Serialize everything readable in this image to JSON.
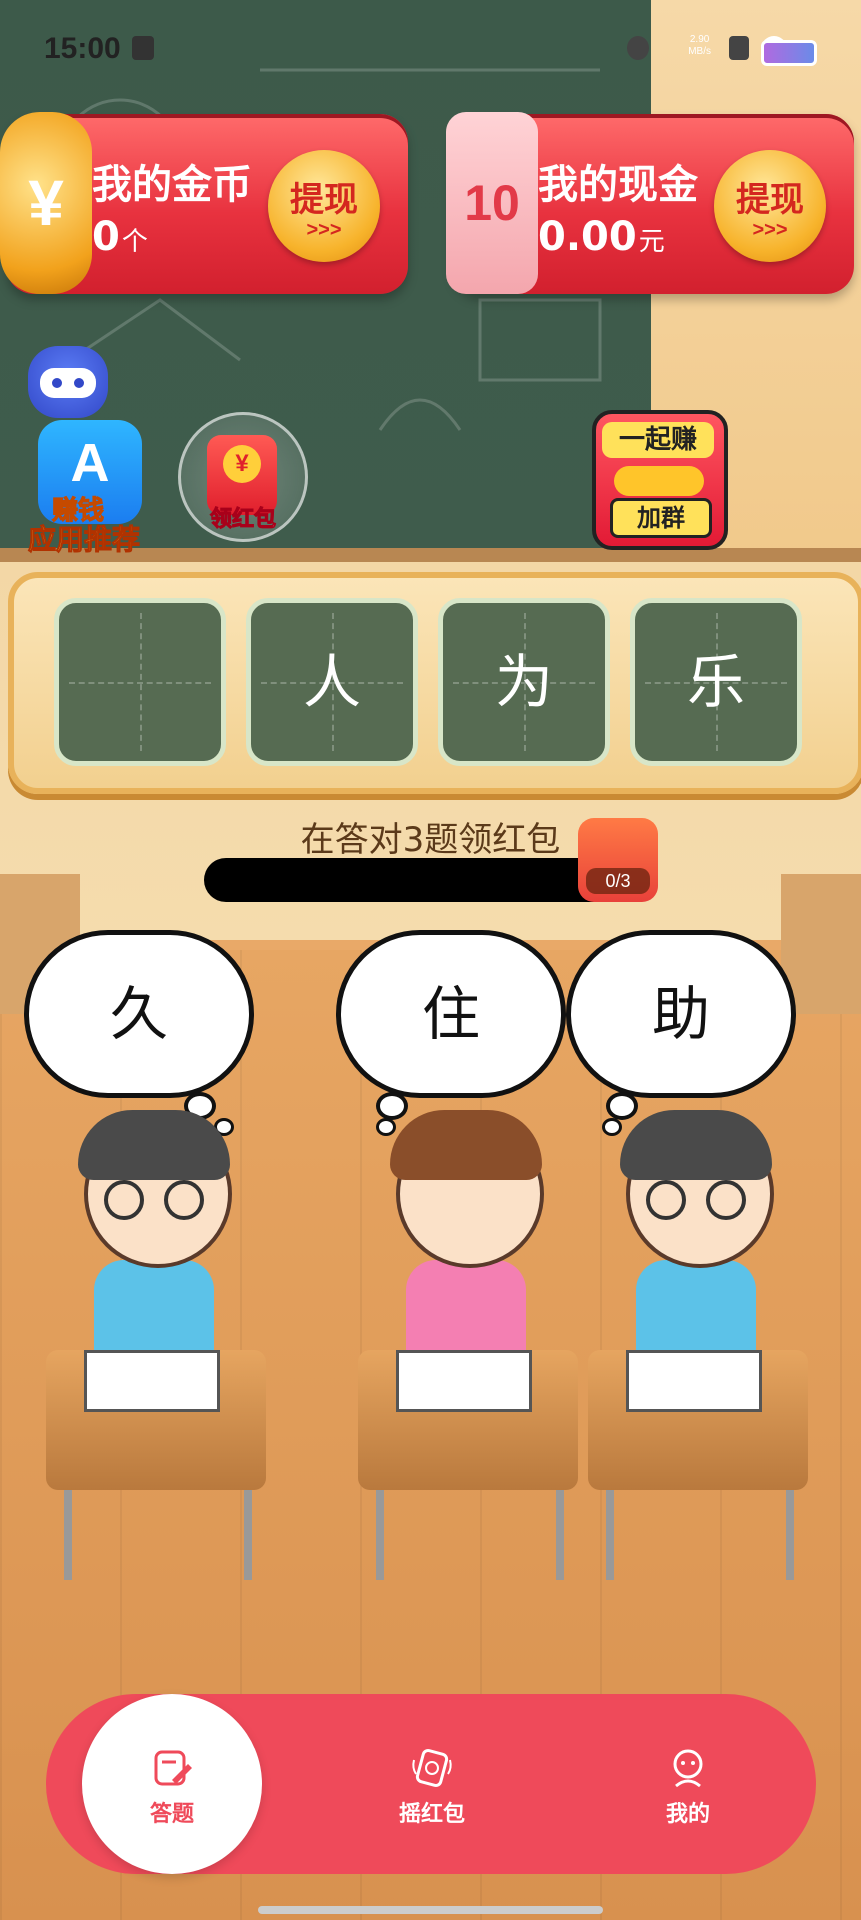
{
  "status_bar": {
    "time": "15:00",
    "network_speed_value": "2.90",
    "network_speed_unit": "MB/s"
  },
  "coins_card": {
    "title": "我的金币",
    "amount": "0",
    "unit": "个",
    "withdraw_label": "提现",
    "withdraw_arrows": ">>>",
    "emblem": "¥"
  },
  "cash_card": {
    "title": "我的现金",
    "amount": "0.00",
    "unit": "元",
    "withdraw_label": "提现",
    "withdraw_arrows": ">>>",
    "emblem": "10"
  },
  "app_recommend": {
    "badge": "赚钱",
    "label": "应用推荐"
  },
  "red_packet": {
    "label": "领红包",
    "coin": "¥"
  },
  "join_group": {
    "top": "一起赚",
    "bottom": "加群"
  },
  "idiom_cells": [
    "",
    "人",
    "为",
    "乐"
  ],
  "progress": {
    "hint": "在答对3题领红包",
    "count": "0/3",
    "fraction": 0
  },
  "choices": [
    "久",
    "住",
    "助"
  ],
  "tabs": [
    {
      "label": "答题",
      "icon": "quiz-edit-icon",
      "active": true
    },
    {
      "label": "摇红包",
      "icon": "shake-redpacket-icon",
      "active": false
    },
    {
      "label": "我的",
      "icon": "profile-icon",
      "active": false
    }
  ],
  "colors": {
    "accent_red": "#ef4a5a",
    "board_green": "#566b52",
    "gold": "#f7b32b"
  }
}
